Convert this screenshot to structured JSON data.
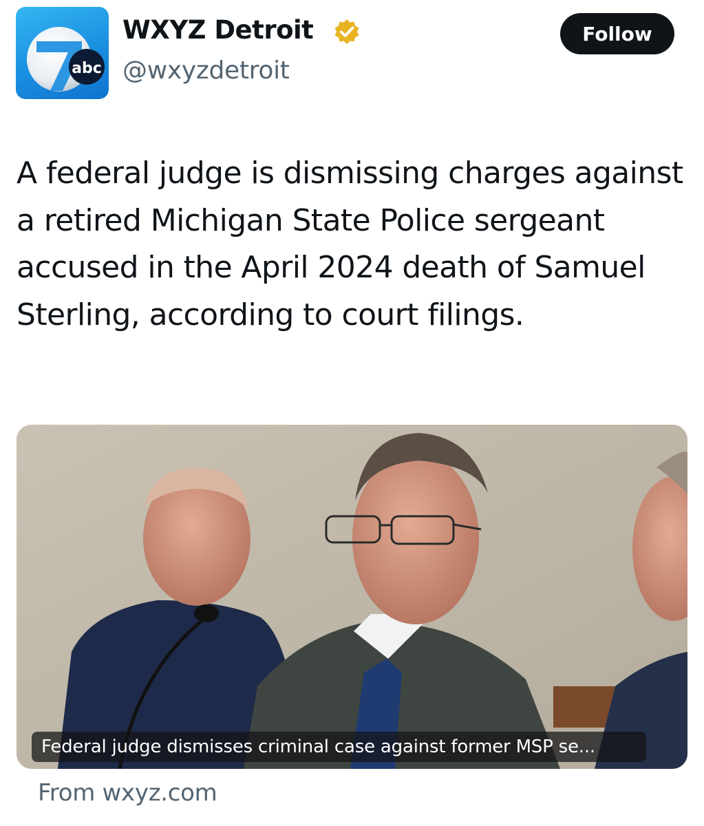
{
  "account": {
    "display_name": "WXYZ Detroit",
    "handle": "@wxyzdetroit",
    "verified": true,
    "verified_badge_color": "#e8b422",
    "avatar_icon": "abc-7-logo-icon",
    "avatar_logo_text": "abc"
  },
  "follow_button": {
    "label": "Follow"
  },
  "tweet": {
    "text": "A federal judge is dismissing charges against a retired Michigan State Police sergeant accused in the April 2024 death of Samuel Sterling, according to court filings."
  },
  "link_card": {
    "caption": "Federal judge dismisses criminal case against former MSP se...",
    "source": "From wxyz.com"
  },
  "colors": {
    "text_primary": "#0f1419",
    "text_secondary": "#536471",
    "follow_bg": "#0f1419",
    "avatar_blue": "#1a8fe0"
  }
}
